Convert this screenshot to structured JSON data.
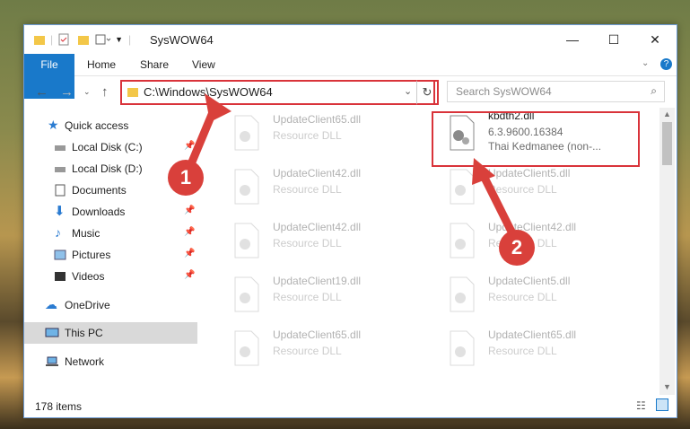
{
  "window": {
    "title": "SysWOW64"
  },
  "ribbon": {
    "tabs": [
      "File",
      "Home",
      "Share",
      "View"
    ]
  },
  "address": {
    "path": "C:\\Windows\\SysWOW64"
  },
  "search": {
    "placeholder": "Search SysWOW64"
  },
  "nav": {
    "items": [
      {
        "label": "Quick access",
        "icon": "star-icon",
        "pinned": false
      },
      {
        "label": "Local Disk (C:)",
        "icon": "drive-icon",
        "pinned": true
      },
      {
        "label": "Local Disk (D:)",
        "icon": "drive-icon",
        "pinned": false
      },
      {
        "label": "Documents",
        "icon": "documents-icon",
        "pinned": true
      },
      {
        "label": "Downloads",
        "icon": "download-icon",
        "pinned": true
      },
      {
        "label": "Music",
        "icon": "music-icon",
        "pinned": true
      },
      {
        "label": "Pictures",
        "icon": "pictures-icon",
        "pinned": true
      },
      {
        "label": "Videos",
        "icon": "videos-icon",
        "pinned": true
      },
      {
        "label": "OneDrive",
        "icon": "cloud-icon",
        "pinned": false
      },
      {
        "label": "This PC",
        "icon": "pc-icon",
        "pinned": false
      },
      {
        "label": "Network",
        "icon": "network-icon",
        "pinned": false
      }
    ]
  },
  "files": [
    {
      "name": "UpdateClient65.dll",
      "type": "Resource DLL"
    },
    {
      "name": "kbdth2.dll",
      "version": "6.3.9600.16384",
      "desc": "Thai Kedmanee (non-..."
    },
    {
      "name": "UpdateClient42.dll",
      "type": "Resource DLL"
    },
    {
      "name": "UpdateClient5.dll",
      "type": "Resource DLL"
    },
    {
      "name": "UpdateClient42.dll",
      "type": "Resource DLL"
    },
    {
      "name": "UpdateClient42.dll",
      "type": "Resource DLL"
    },
    {
      "name": "UpdateClient19.dll",
      "type": "Resource DLL"
    },
    {
      "name": "UpdateClient5.dll",
      "type": "Resource DLL"
    },
    {
      "name": "UpdateClient65.dll",
      "type": "Resource DLL"
    },
    {
      "name": "UpdateClient65.dll",
      "type": "Resource DLL"
    }
  ],
  "status": {
    "count": "178 items"
  },
  "callouts": [
    "1",
    "2"
  ],
  "colors": {
    "accent": "#1979ca",
    "highlight": "#d9333a"
  }
}
